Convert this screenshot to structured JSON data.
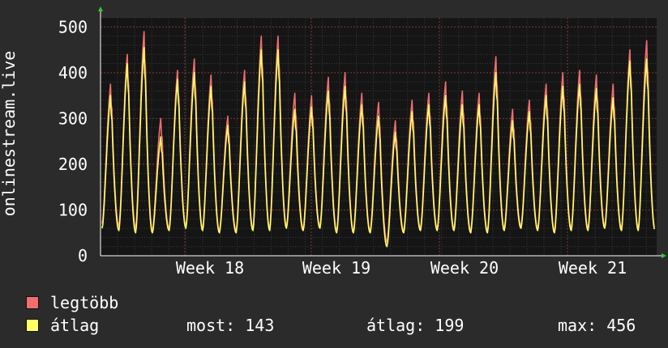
{
  "chart_data": {
    "type": "line",
    "ylabel": "onlinestream.live",
    "ylim": [
      0,
      520
    ],
    "yticks": [
      0,
      100,
      200,
      300,
      400,
      500
    ],
    "grid": true,
    "week_labels": [
      "Week 18",
      "Week 19",
      "Week 20",
      "Week 21"
    ],
    "days": 28,
    "series": [
      {
        "name": "legtöbb",
        "color": "#f06e6e",
        "daily_peaks": [
          375,
          440,
          490,
          300,
          405,
          430,
          395,
          305,
          405,
          480,
          480,
          355,
          350,
          390,
          400,
          355,
          335,
          295,
          340,
          355,
          380,
          360,
          355,
          435,
          320,
          340,
          375,
          400,
          405,
          395,
          375,
          450,
          470
        ],
        "daily_mins": [
          70,
          65,
          60,
          55,
          60,
          65,
          60,
          55,
          55,
          60,
          60,
          65,
          60,
          65,
          55,
          55,
          55,
          30,
          55,
          60,
          60,
          60,
          55,
          55,
          60,
          65,
          60,
          55,
          60,
          60,
          65,
          60,
          60
        ]
      },
      {
        "name": "átlag",
        "color": "#ffff66",
        "daily_peaks": [
          350,
          420,
          455,
          260,
          385,
          400,
          370,
          285,
          380,
          450,
          450,
          320,
          325,
          360,
          370,
          330,
          305,
          270,
          315,
          330,
          350,
          330,
          330,
          400,
          295,
          315,
          350,
          370,
          375,
          365,
          345,
          425,
          430
        ],
        "daily_mins": [
          60,
          55,
          50,
          50,
          55,
          60,
          55,
          50,
          50,
          55,
          55,
          60,
          55,
          60,
          50,
          50,
          50,
          20,
          50,
          55,
          55,
          55,
          50,
          50,
          55,
          60,
          55,
          50,
          55,
          55,
          60,
          55,
          55
        ]
      }
    ]
  },
  "legend": {
    "max_label": "legtöbb",
    "avg_label": "átlag",
    "max_color": "#f06e6e",
    "avg_color": "#ffff66"
  },
  "stats": {
    "most": "most: 143",
    "atlag": "átlag: 199",
    "max": "max: 456"
  }
}
